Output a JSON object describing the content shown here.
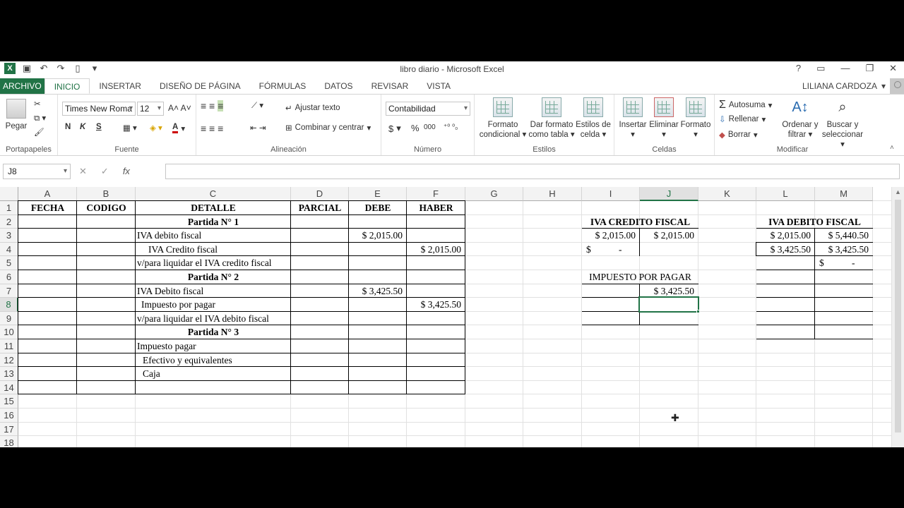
{
  "window": {
    "title": "libro diario - Microsoft Excel",
    "user": "LILIANA CARDOZA"
  },
  "tabs": [
    "ARCHIVO",
    "INICIO",
    "INSERTAR",
    "DISEÑO DE PÁGINA",
    "FÓRMULAS",
    "DATOS",
    "REVISAR",
    "VISTA"
  ],
  "ribbon": {
    "clipboard": {
      "paste": "Pegar",
      "label": "Portapapeles"
    },
    "font": {
      "name": "Times New Roma",
      "size": "12",
      "bold": "N",
      "italic": "K",
      "underline": "S",
      "label": "Fuente"
    },
    "alignment": {
      "wrap": "Ajustar texto",
      "merge": "Combinar y centrar",
      "label": "Alineación"
    },
    "number": {
      "format": "Contabilidad",
      "currency": "$",
      "percent": "%",
      "thousands": "000",
      "label": "Número"
    },
    "styles": {
      "cond1": "Formato",
      "cond2": "condicional",
      "table1": "Dar formato",
      "table2": "como tabla",
      "cell1": "Estilos de",
      "cell2": "celda",
      "label": "Estilos"
    },
    "cells": {
      "insert": "Insertar",
      "delete": "Eliminar",
      "format": "Formato",
      "label": "Celdas"
    },
    "editing": {
      "autosum": "Autosuma",
      "fill": "Rellenar",
      "clear": "Borrar",
      "sort1": "Ordenar y",
      "sort2": "filtrar",
      "find1": "Buscar y",
      "find2": "seleccionar",
      "label": "Modificar"
    }
  },
  "formula_bar": {
    "name_box": "J8",
    "fx": "fx",
    "value": ""
  },
  "columns": [
    "A",
    "B",
    "C",
    "D",
    "E",
    "F",
    "G",
    "H",
    "I",
    "J",
    "K",
    "L",
    "M"
  ],
  "rows": [
    "1",
    "2",
    "3",
    "4",
    "5",
    "6",
    "7",
    "8",
    "9",
    "10",
    "11",
    "12",
    "13",
    "14",
    "15",
    "16",
    "17",
    "18"
  ],
  "sheet": {
    "h_fecha": "FECHA",
    "h_codigo": "CODIGO",
    "h_detalle": "DETALLE",
    "h_parcial": "PARCIAL",
    "h_debe": "DEBE",
    "h_haber": "HABER",
    "p1": "Partida N° 1",
    "r3c": "IVA debito fiscal",
    "r3e": "$ 2,015.00",
    "r4c": "IVA Credito fiscal",
    "r4f": "$ 2,015.00",
    "r5c": "v/para liquidar el IVA credito fiscal",
    "p2": "Partida N° 2",
    "r7c": "IVA Debito fiscal",
    "r7e": "$ 3,425.50",
    "r8c": "Impuesto por pagar",
    "r8f": "$ 3,425.50",
    "r9c": "v/para liquidar el IVA debito fiscal",
    "p3": "Partida N° 3",
    "r11c": "Impuesto pagar",
    "r12c": "Efectivo y equivalentes",
    "r13c": "Caja",
    "t1_title": "IVA CREDITO FISCAL",
    "t1_i3": "$ 2,015.00",
    "t1_j3": "$ 2,015.00",
    "t1_i4a": "$",
    "t1_i4b": "-",
    "t2_title": "IVA DEBITO FISCAL",
    "t2_l3": "$ 2,015.00",
    "t2_m3": "$ 5,440.50",
    "t2_l4": "$ 3,425.50",
    "t2_m4": "$ 3,425.50",
    "t2_m5a": "$",
    "t2_m5b": "-",
    "t3_title": "IMPUESTO POR PAGAR",
    "t3_j7": "$ 3,425.50"
  }
}
